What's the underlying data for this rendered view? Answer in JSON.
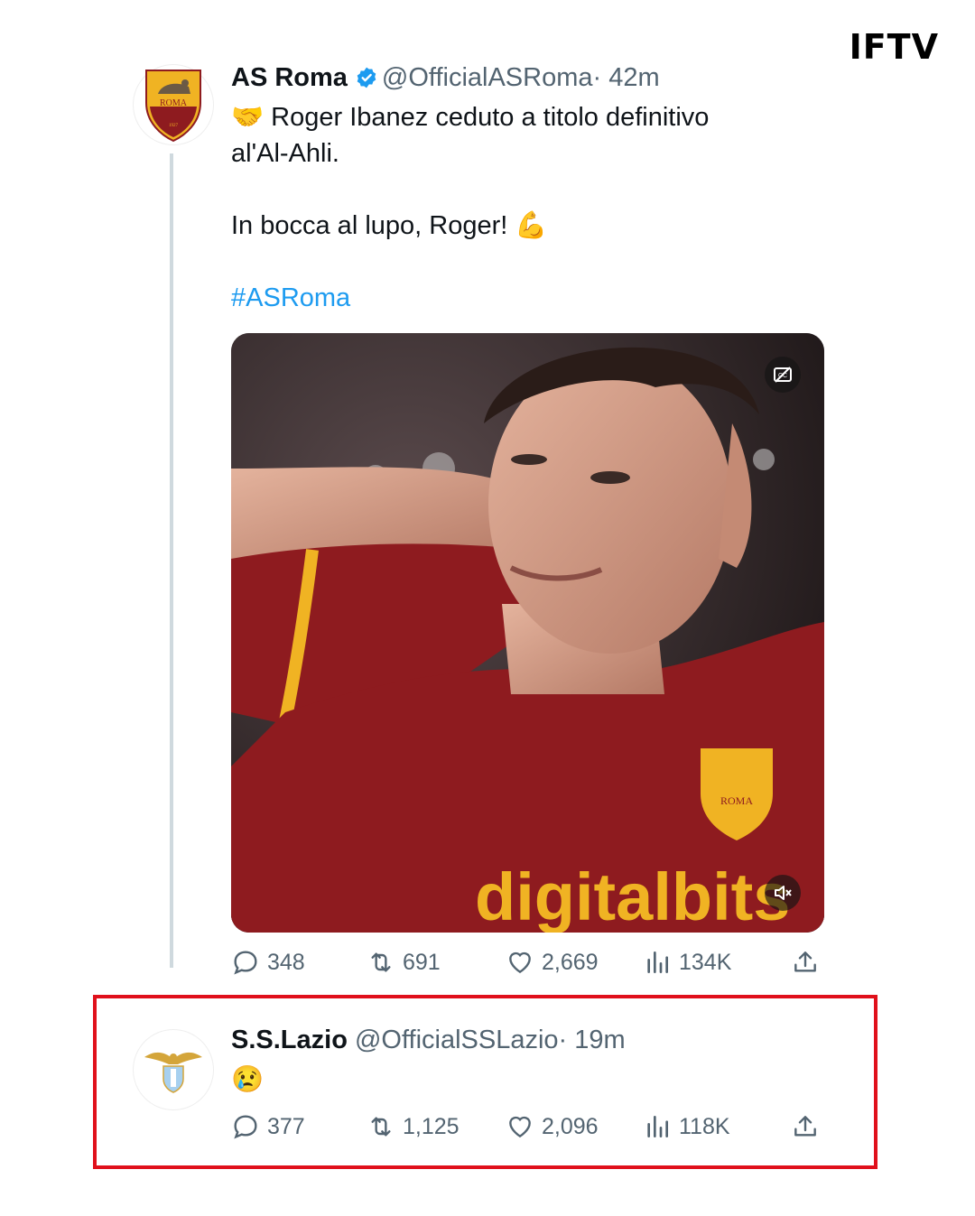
{
  "brand": "IFTV",
  "tweet1": {
    "display_name": "AS Roma",
    "handle": "@OfficialASRoma",
    "time": "· 42m",
    "text_line1": "Roger Ibanez ceduto a titolo definitivo",
    "text_line2": "al'Al-Ahli.",
    "text_line3": "In bocca al lupo, Roger!",
    "hashtag": "#ASRoma",
    "emoji_handshake": "🤝",
    "emoji_flex": "💪",
    "avatar_crest_text": "ROMA",
    "avatar_crest_year": "1927",
    "stats": {
      "replies": "348",
      "reposts": "691",
      "likes": "2,669",
      "views": "134K"
    }
  },
  "tweet2": {
    "display_name": "S.S.Lazio",
    "handle": "@OfficialSSLazio",
    "time": "· 19m",
    "emoji": "😢",
    "stats": {
      "replies": "377",
      "reposts": "1,125",
      "likes": "2,096",
      "views": "118K"
    }
  },
  "media": {
    "jersey_sponsor": "digitalbits",
    "jersey_crest_text": "ROMA",
    "icons": [
      "captions-off-icon",
      "mute-icon"
    ]
  },
  "colors": {
    "accent": "#1d9bf0",
    "verified": "#1d9bf0",
    "highlight": "#e0101b",
    "jersey": "#8e1b1f",
    "gold": "#f0b323"
  }
}
